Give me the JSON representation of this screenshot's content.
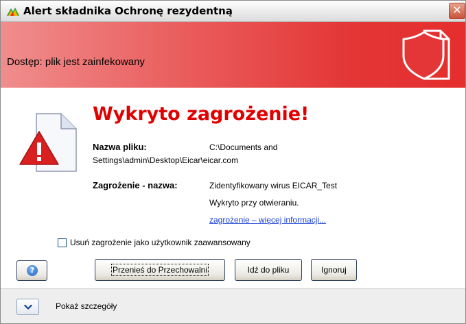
{
  "window": {
    "title": "Alert składnika Ochronę rezydentną",
    "close_glyph": "✕"
  },
  "header": {
    "text": "Dostęp: plik jest zainfekowany",
    "icon": "shield-document-icon",
    "gradient_colors": [
      "#f08d8d",
      "#e52e2e"
    ]
  },
  "alert": {
    "headline": "Wykryto zagrożenie!",
    "headline_color": "#e00000",
    "icon": "warning-document-icon",
    "file_name_label": "Nazwa pliku:",
    "file_name_value_1": "C:\\Documents and",
    "file_name_value_2": "Settings\\admin\\Desktop\\Eicar\\eicar.com",
    "threat_label": "Zagrożenie - nazwa:",
    "threat_value": "Zidentyfikowany wirus EICAR_Test",
    "detected_text": "Wykryto przy otwieraniu.",
    "more_info_link": "zagrożenie – więcej informacji...",
    "link_color": "#1a3fd6"
  },
  "options": {
    "advanced_checkbox_label": "Usuń zagrożenie jako użytkownik zaawansowany",
    "advanced_checkbox_checked": false
  },
  "buttons": {
    "help_glyph": "?",
    "move_to_vault": "Przenieś do Przechowalni",
    "go_to_file": "Idź do pliku",
    "ignore": "Ignoruj"
  },
  "footer": {
    "show_details": "Pokaż szczegóły"
  }
}
